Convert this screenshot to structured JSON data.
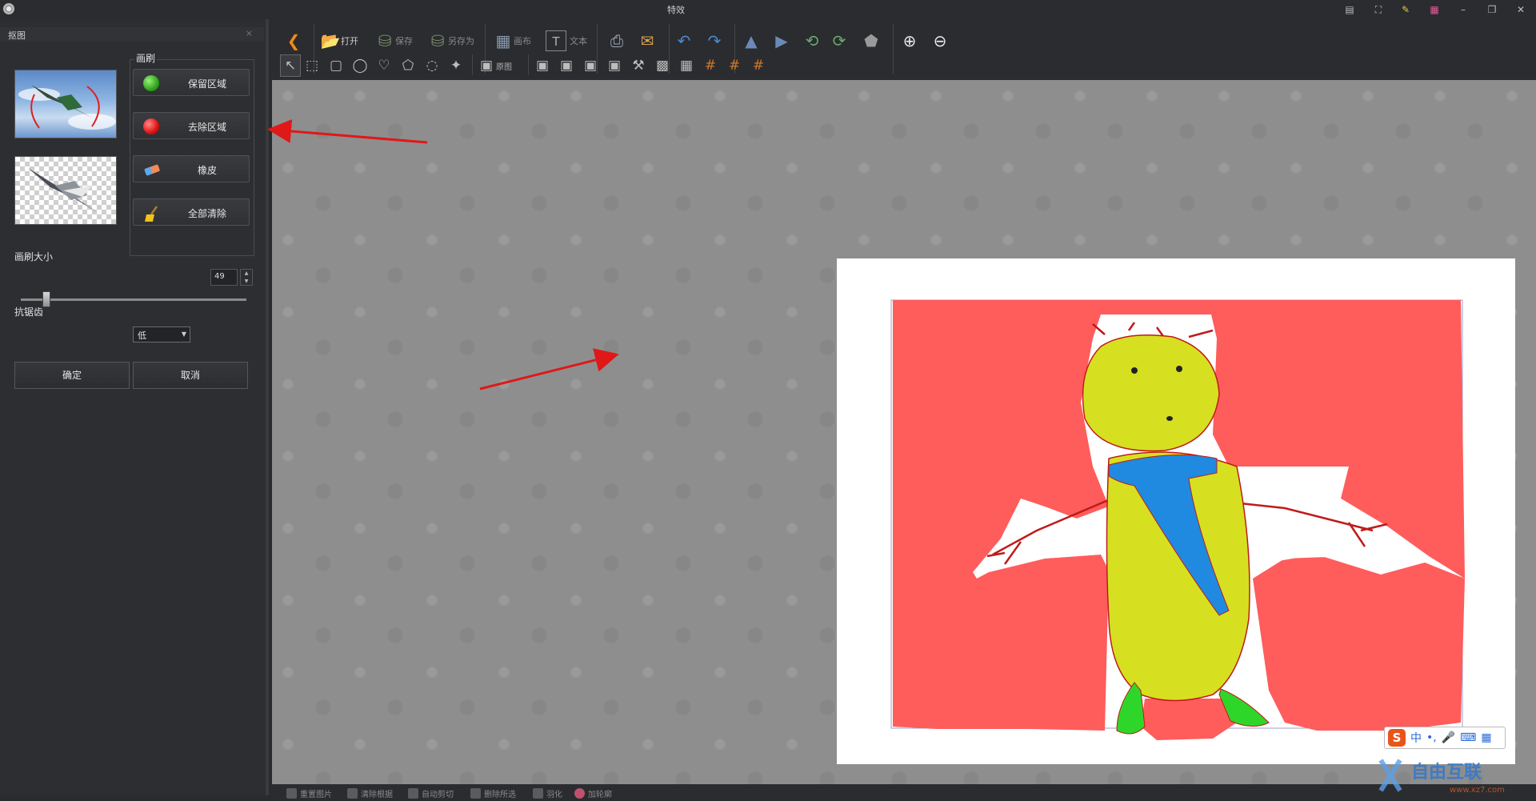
{
  "window": {
    "title": "特效"
  },
  "panel": {
    "title": "抠图",
    "close": "×",
    "brush_group_title": "画刷",
    "buttons": {
      "keep": "保留区域",
      "remove": "去除区域",
      "eraser": "橡皮",
      "clear": "全部清除"
    },
    "brush_size_label": "画刷大小",
    "brush_size_value": "49",
    "brush_size_fraction": 0.1,
    "antialias_label": "抗锯齿",
    "antialias_value": "低",
    "ok": "确定",
    "cancel": "取消"
  },
  "toolbar": {
    "open": "打开",
    "save": "保存",
    "save_as": "另存为",
    "canvas": "画布",
    "text": "文本",
    "original": "原图"
  },
  "statusbar": {
    "items": [
      "重置图片",
      "清除根据",
      "自动剪切",
      "删除所选",
      "羽化",
      "加轮廓"
    ]
  },
  "ime": {
    "lang": "中"
  },
  "watermark": {
    "text": "自由互联",
    "url": "www.xz7.com"
  },
  "colors": {
    "remove_overlay": "#ff5c5c",
    "figure_body": "#d6e020",
    "scarf": "#1f8ae0",
    "feet": "#2fd62a",
    "annotation_arrow": "#e01818"
  }
}
